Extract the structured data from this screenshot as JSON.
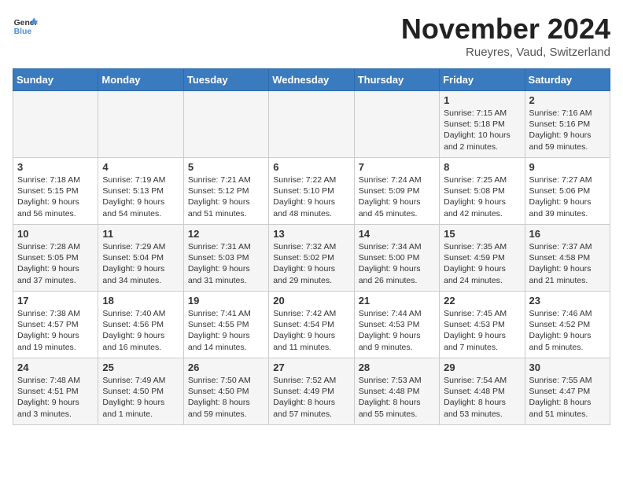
{
  "header": {
    "logo_line1": "General",
    "logo_line2": "Blue",
    "month": "November 2024",
    "location": "Rueyres, Vaud, Switzerland"
  },
  "weekdays": [
    "Sunday",
    "Monday",
    "Tuesday",
    "Wednesday",
    "Thursday",
    "Friday",
    "Saturday"
  ],
  "weeks": [
    [
      {
        "day": "",
        "info": ""
      },
      {
        "day": "",
        "info": ""
      },
      {
        "day": "",
        "info": ""
      },
      {
        "day": "",
        "info": ""
      },
      {
        "day": "",
        "info": ""
      },
      {
        "day": "1",
        "info": "Sunrise: 7:15 AM\nSunset: 5:18 PM\nDaylight: 10 hours\nand 2 minutes."
      },
      {
        "day": "2",
        "info": "Sunrise: 7:16 AM\nSunset: 5:16 PM\nDaylight: 9 hours\nand 59 minutes."
      }
    ],
    [
      {
        "day": "3",
        "info": "Sunrise: 7:18 AM\nSunset: 5:15 PM\nDaylight: 9 hours\nand 56 minutes."
      },
      {
        "day": "4",
        "info": "Sunrise: 7:19 AM\nSunset: 5:13 PM\nDaylight: 9 hours\nand 54 minutes."
      },
      {
        "day": "5",
        "info": "Sunrise: 7:21 AM\nSunset: 5:12 PM\nDaylight: 9 hours\nand 51 minutes."
      },
      {
        "day": "6",
        "info": "Sunrise: 7:22 AM\nSunset: 5:10 PM\nDaylight: 9 hours\nand 48 minutes."
      },
      {
        "day": "7",
        "info": "Sunrise: 7:24 AM\nSunset: 5:09 PM\nDaylight: 9 hours\nand 45 minutes."
      },
      {
        "day": "8",
        "info": "Sunrise: 7:25 AM\nSunset: 5:08 PM\nDaylight: 9 hours\nand 42 minutes."
      },
      {
        "day": "9",
        "info": "Sunrise: 7:27 AM\nSunset: 5:06 PM\nDaylight: 9 hours\nand 39 minutes."
      }
    ],
    [
      {
        "day": "10",
        "info": "Sunrise: 7:28 AM\nSunset: 5:05 PM\nDaylight: 9 hours\nand 37 minutes."
      },
      {
        "day": "11",
        "info": "Sunrise: 7:29 AM\nSunset: 5:04 PM\nDaylight: 9 hours\nand 34 minutes."
      },
      {
        "day": "12",
        "info": "Sunrise: 7:31 AM\nSunset: 5:03 PM\nDaylight: 9 hours\nand 31 minutes."
      },
      {
        "day": "13",
        "info": "Sunrise: 7:32 AM\nSunset: 5:02 PM\nDaylight: 9 hours\nand 29 minutes."
      },
      {
        "day": "14",
        "info": "Sunrise: 7:34 AM\nSunset: 5:00 PM\nDaylight: 9 hours\nand 26 minutes."
      },
      {
        "day": "15",
        "info": "Sunrise: 7:35 AM\nSunset: 4:59 PM\nDaylight: 9 hours\nand 24 minutes."
      },
      {
        "day": "16",
        "info": "Sunrise: 7:37 AM\nSunset: 4:58 PM\nDaylight: 9 hours\nand 21 minutes."
      }
    ],
    [
      {
        "day": "17",
        "info": "Sunrise: 7:38 AM\nSunset: 4:57 PM\nDaylight: 9 hours\nand 19 minutes."
      },
      {
        "day": "18",
        "info": "Sunrise: 7:40 AM\nSunset: 4:56 PM\nDaylight: 9 hours\nand 16 minutes."
      },
      {
        "day": "19",
        "info": "Sunrise: 7:41 AM\nSunset: 4:55 PM\nDaylight: 9 hours\nand 14 minutes."
      },
      {
        "day": "20",
        "info": "Sunrise: 7:42 AM\nSunset: 4:54 PM\nDaylight: 9 hours\nand 11 minutes."
      },
      {
        "day": "21",
        "info": "Sunrise: 7:44 AM\nSunset: 4:53 PM\nDaylight: 9 hours\nand 9 minutes."
      },
      {
        "day": "22",
        "info": "Sunrise: 7:45 AM\nSunset: 4:53 PM\nDaylight: 9 hours\nand 7 minutes."
      },
      {
        "day": "23",
        "info": "Sunrise: 7:46 AM\nSunset: 4:52 PM\nDaylight: 9 hours\nand 5 minutes."
      }
    ],
    [
      {
        "day": "24",
        "info": "Sunrise: 7:48 AM\nSunset: 4:51 PM\nDaylight: 9 hours\nand 3 minutes."
      },
      {
        "day": "25",
        "info": "Sunrise: 7:49 AM\nSunset: 4:50 PM\nDaylight: 9 hours\nand 1 minute."
      },
      {
        "day": "26",
        "info": "Sunrise: 7:50 AM\nSunset: 4:50 PM\nDaylight: 8 hours\nand 59 minutes."
      },
      {
        "day": "27",
        "info": "Sunrise: 7:52 AM\nSunset: 4:49 PM\nDaylight: 8 hours\nand 57 minutes."
      },
      {
        "day": "28",
        "info": "Sunrise: 7:53 AM\nSunset: 4:48 PM\nDaylight: 8 hours\nand 55 minutes."
      },
      {
        "day": "29",
        "info": "Sunrise: 7:54 AM\nSunset: 4:48 PM\nDaylight: 8 hours\nand 53 minutes."
      },
      {
        "day": "30",
        "info": "Sunrise: 7:55 AM\nSunset: 4:47 PM\nDaylight: 8 hours\nand 51 minutes."
      }
    ]
  ]
}
